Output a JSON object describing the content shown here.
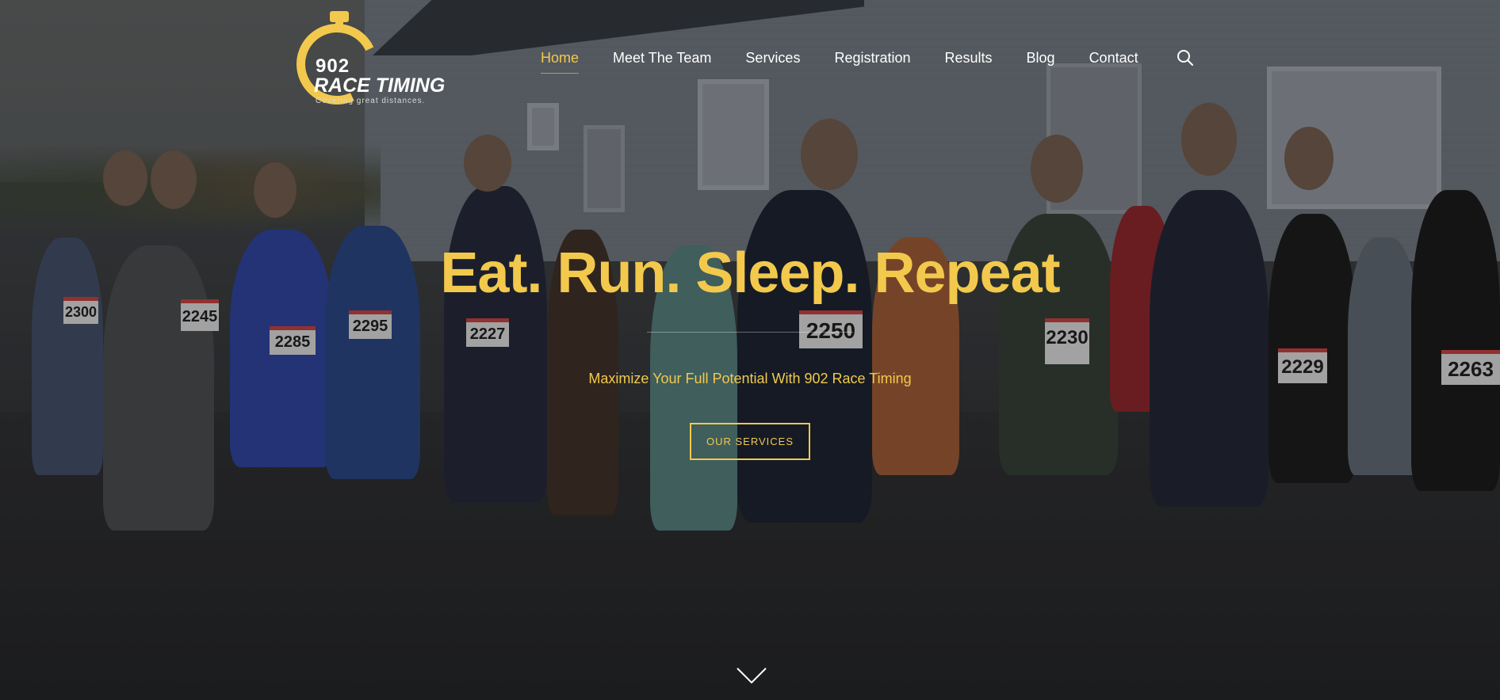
{
  "brand": {
    "logo_number": "902",
    "logo_name": "RACE TIMING",
    "logo_tagline": "Covering great distances.",
    "accent_color": "#f2c94c",
    "logo_icon": "stopwatch-icon"
  },
  "nav": {
    "items": [
      {
        "label": "Home",
        "active": true
      },
      {
        "label": "Meet The Team",
        "active": false
      },
      {
        "label": "Services",
        "active": false
      },
      {
        "label": "Registration",
        "active": false
      },
      {
        "label": "Results",
        "active": false
      },
      {
        "label": "Blog",
        "active": false
      },
      {
        "label": "Contact",
        "active": false
      }
    ],
    "search_icon": "search-icon"
  },
  "hero": {
    "title": "Eat. Run. Sleep. Repeat",
    "subtitle": "Maximize Your Full Potential With 902 Race Timing",
    "button_label": "OUR SERVICES",
    "scroll_icon": "chevron-down-icon"
  },
  "background": {
    "bib_numbers": [
      "2300",
      "2245",
      "2285",
      "2295",
      "2227",
      "2250",
      "2230",
      "2229",
      "2263"
    ]
  }
}
